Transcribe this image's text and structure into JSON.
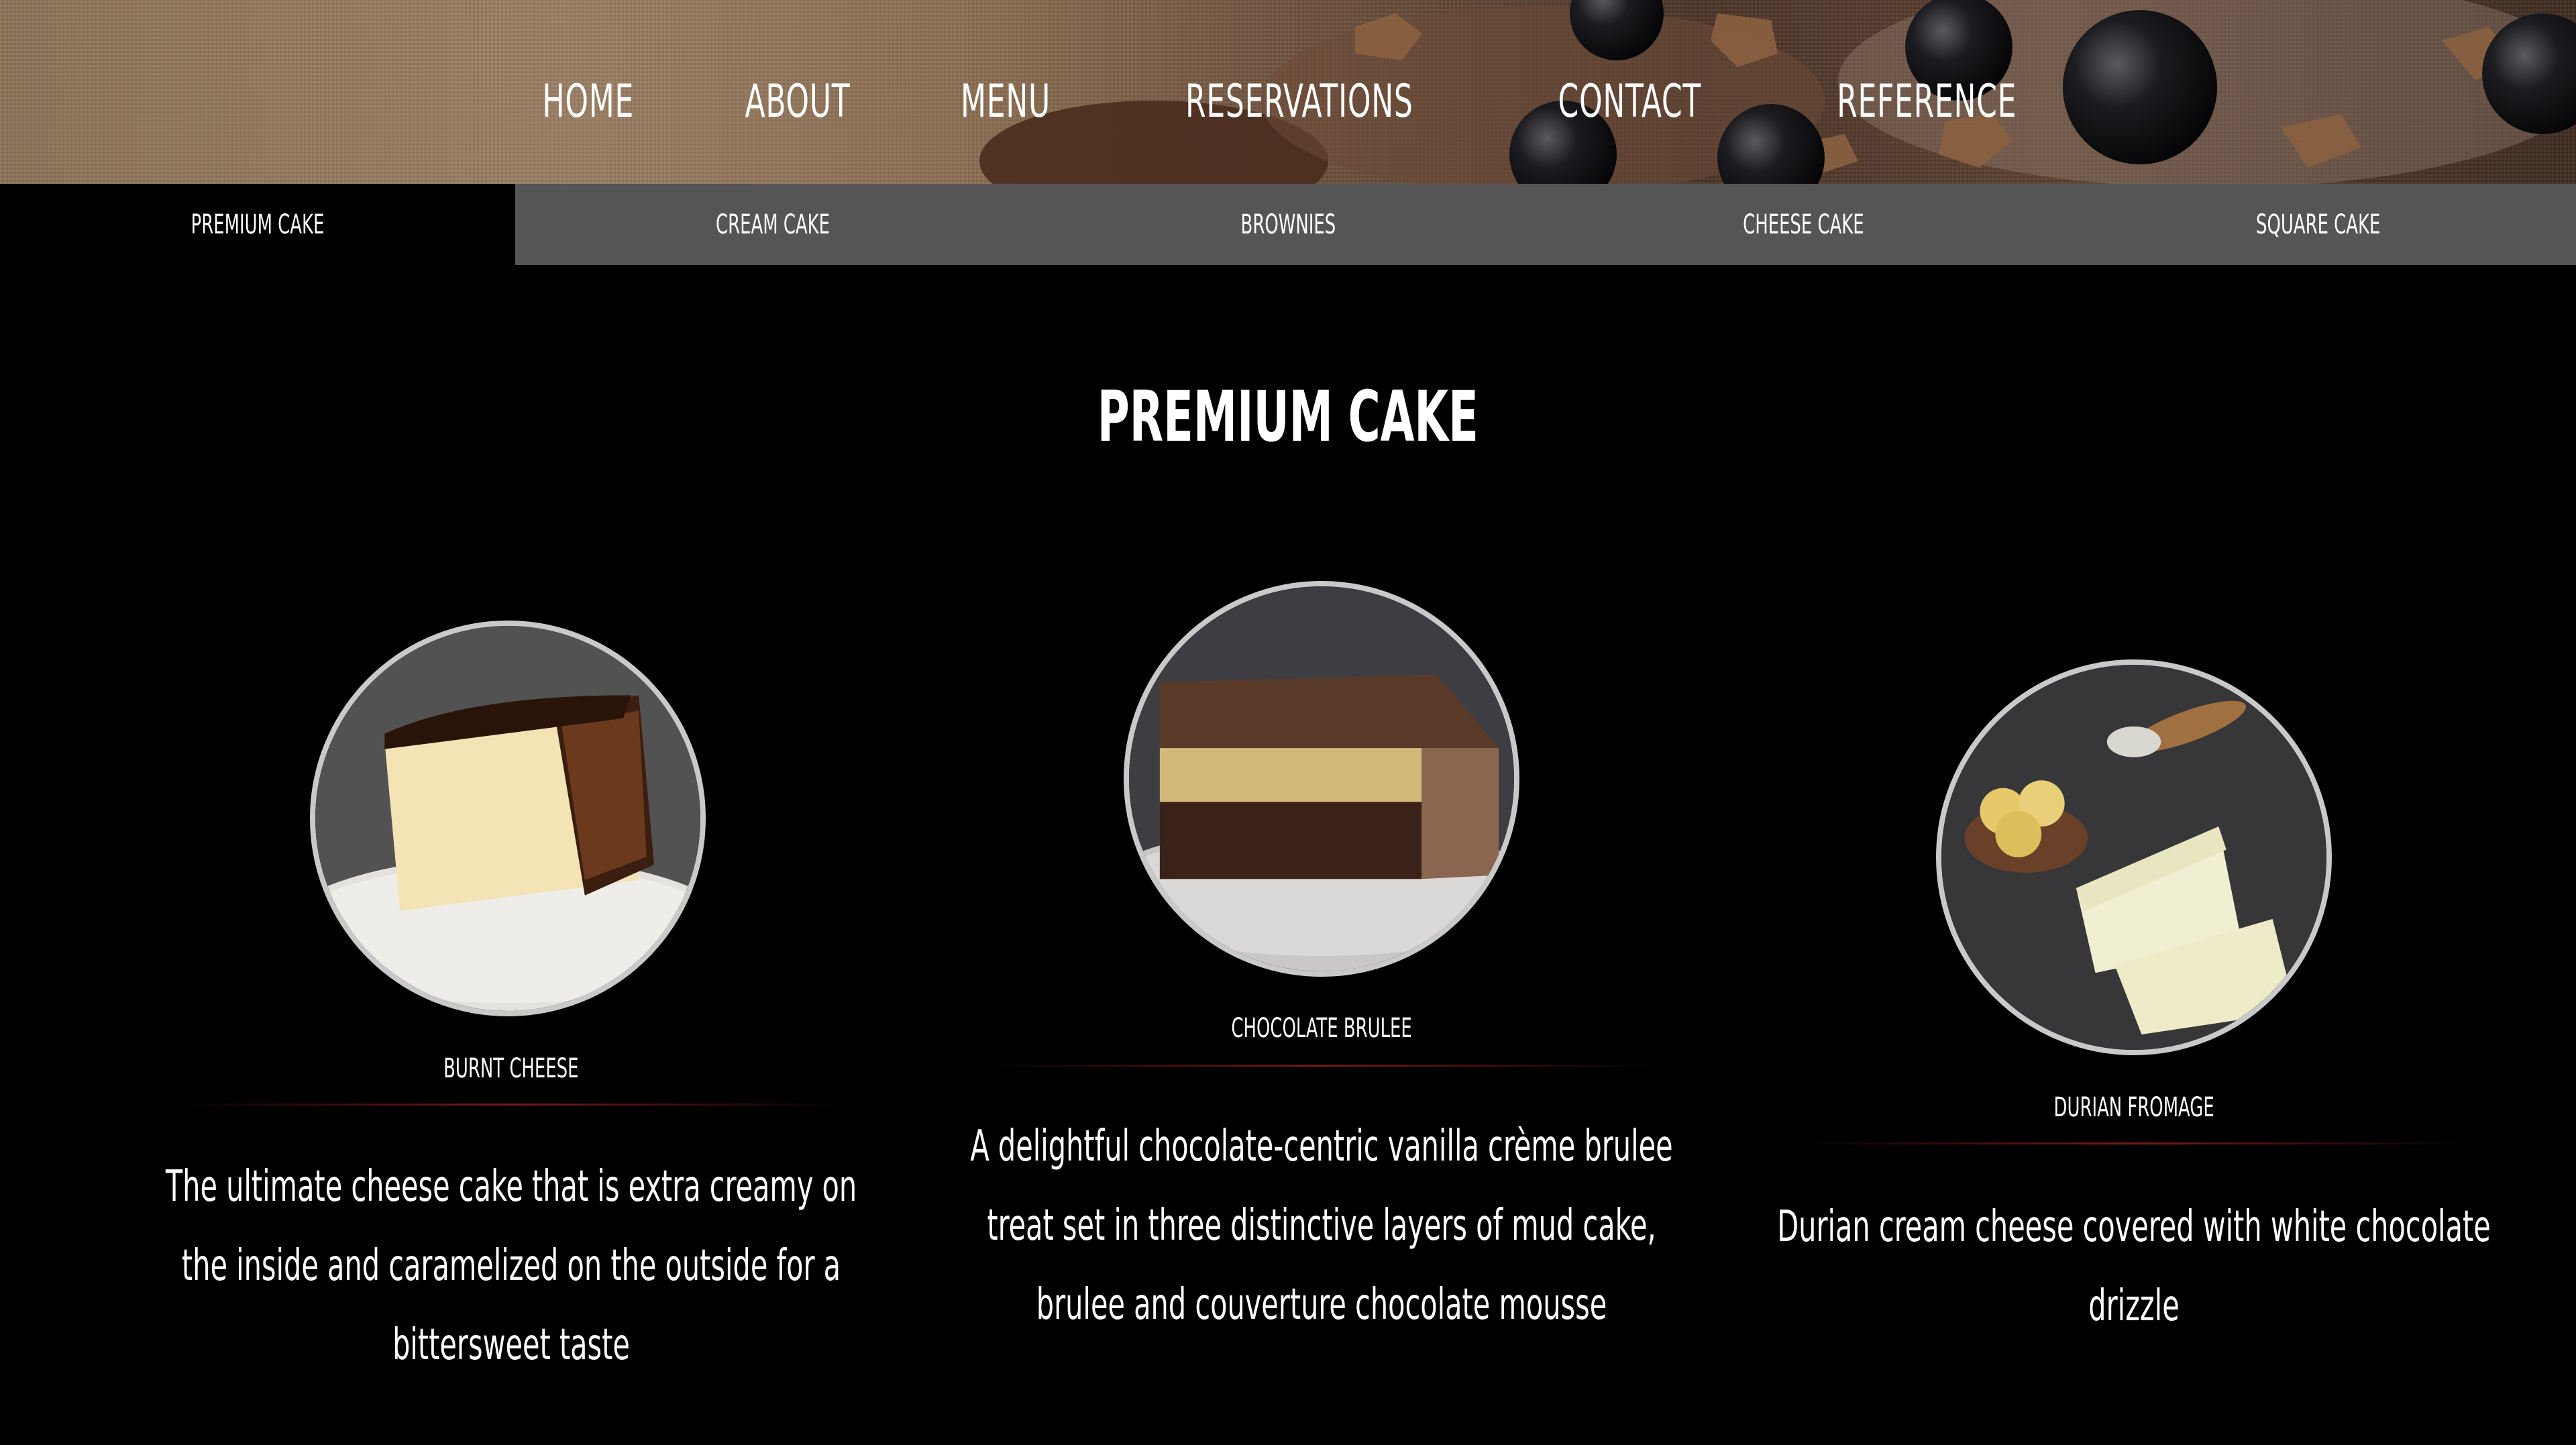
{
  "nav": {
    "items": [
      {
        "label": "HOME"
      },
      {
        "label": "ABOUT"
      },
      {
        "label": "MENU"
      },
      {
        "label": "RESERVATIONS"
      },
      {
        "label": "CONTACT"
      },
      {
        "label": "REFERENCE"
      }
    ]
  },
  "tabs": [
    {
      "label": "PREMIUM CAKE",
      "active": true
    },
    {
      "label": "CREAM CAKE",
      "active": false
    },
    {
      "label": "BROWNIES",
      "active": false
    },
    {
      "label": "CHEESE CAKE",
      "active": false
    },
    {
      "label": "SQUARE CAKE",
      "active": false
    }
  ],
  "section": {
    "title": "PREMIUM CAKE"
  },
  "products": [
    {
      "name": "BURNT CHEESE",
      "description": "The ultimate cheese cake that is extra creamy on the inside and caramelized on the outside for a bittersweet taste"
    },
    {
      "name": "CHOCOLATE BRULEE",
      "description": "A delightful chocolate-centric vanilla crème brulee treat set in three distinctive layers of mud cake, brulee and couverture chocolate mousse"
    },
    {
      "name": "DURIAN FROMAGE",
      "description": "Durian cream cheese covered with white chocolate drizzle"
    }
  ],
  "colors": {
    "background": "#000000",
    "tab_bar": "#555555",
    "tab_active": "#000000",
    "divider": "#7a1a1a",
    "thumb_border": "#c9c9c9"
  }
}
